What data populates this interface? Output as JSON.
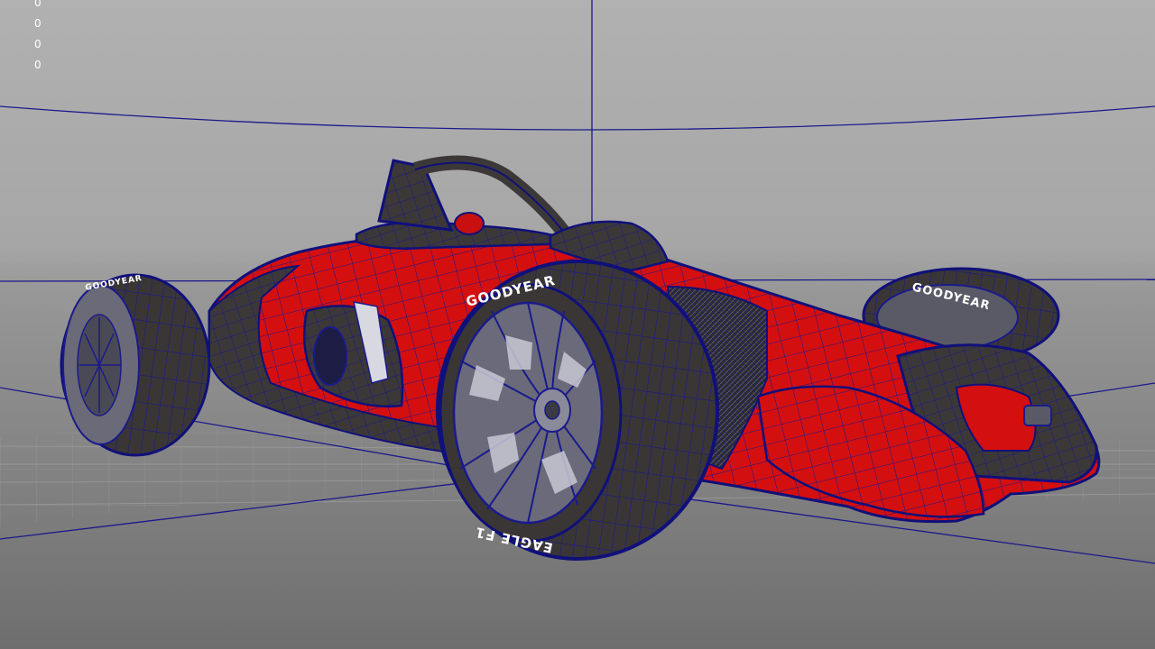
{
  "viewport": {
    "hud_stats": [
      "0",
      "0",
      "0",
      "0"
    ],
    "background_top_color": "#b0b0b0",
    "background_bottom_color": "#7f7f7f",
    "wireframe_color": "#1a1a8c",
    "body_color": "#d40f10",
    "carbon_color": "#3a3638"
  },
  "car": {
    "tire_brand": "GOODYEAR",
    "tire_model": "EAGLE F1",
    "model_icon": "formula-race-car-model"
  }
}
